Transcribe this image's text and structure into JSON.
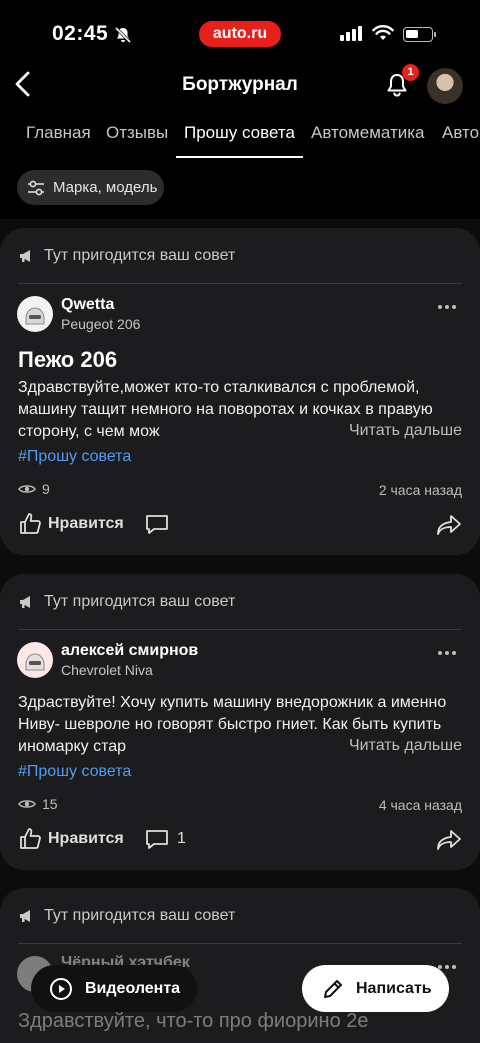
{
  "status_bar": {
    "time": "02:45",
    "brand": "auto.ru"
  },
  "header": {
    "title": "Бортжурнал",
    "notifications_count": "1"
  },
  "tabs": [
    {
      "label": "Главная"
    },
    {
      "label": "Отзывы"
    },
    {
      "label": "Прошу совета"
    },
    {
      "label": "Автомематика"
    },
    {
      "label": "Авто"
    }
  ],
  "filter": {
    "label": "Марка, модель"
  },
  "section_label": "Тут пригодится ваш совет",
  "posts": [
    {
      "author": "Qwetta",
      "car": "Peugeot 206",
      "title": "Пежо 206",
      "body": "Здравствуйте,может кто-то сталкивался с проблемой, машину тащит немного на поворотах и кочках в правую сторону, с чем мож",
      "read_more": "Читать дальше",
      "hashtag": "#Прошу совета",
      "views": "9",
      "time": "2 часа назад",
      "like_label": "Нравится",
      "comments": ""
    },
    {
      "author": "алексей смирнов",
      "car": "Chevrolet Niva",
      "title": "",
      "body": "Здраствуйте! Хочу купить машину внедорожник а именно Ниву- шевроле но говорят быстро гниет. Как быть купить иномарку стар",
      "read_more": "Читать дальше",
      "hashtag": "#Прошу совета",
      "views": "15",
      "time": "4 часа назад",
      "like_label": "Нравится",
      "comments": "1"
    },
    {
      "author": "Чёрный хэтчбек",
      "body": "Здравствуйте, что-то про фиорино 2е"
    }
  ],
  "bottom": {
    "video_label": "Видеолента",
    "write_label": "Написать"
  }
}
